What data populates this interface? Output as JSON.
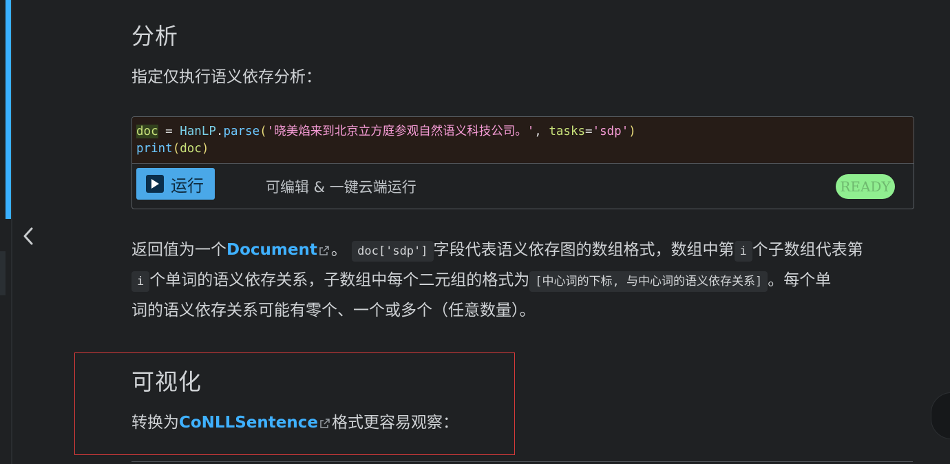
{
  "section_analysis": {
    "heading": "分析",
    "intro": "指定仅执行语义依存分析："
  },
  "code": {
    "line1": {
      "var": "doc",
      "op": " = ",
      "cls": "HanLP",
      "dot": ".",
      "fn": "parse",
      "open": "(",
      "str1": "'晓美焰来到北京立方庭参观自然语义科技公司。'",
      "comma": ", ",
      "kw": "tasks",
      "eq": "=",
      "str2": "'sdp'",
      "close": ")"
    },
    "line2": {
      "fn": "print",
      "open": "(",
      "arg": "doc",
      "close": ")"
    },
    "run_label": "运行",
    "hint": "可编辑 & 一键云端运行",
    "status": "READY"
  },
  "result_paragraph": {
    "p1": "返回值为一个",
    "link": "Document",
    "p2": "。",
    "code1": "doc['sdp']",
    "p3": "字段代表语义依存图的数组格式，数组中第",
    "code2": "i",
    "p4": "个子数组代表第",
    "code3": "i",
    "p5": "个单词的语义依存关系，子数组中每个二元组的格式为",
    "code4": "[中心词的下标, 与中心词的语义依存关系]",
    "p6": "。每个单",
    "p7": "词的语义依存关系可能有零个、一个或多个（任意数量）。"
  },
  "section_visualize": {
    "heading": "可视化",
    "p1": "转换为",
    "link": "CoNLLSentence",
    "p2": "格式更容易观察："
  },
  "colors": {
    "accent": "#3ab0ff",
    "link": "#3fb1ff",
    "run_button": "#4aa8e8",
    "ready_badge": "#90ee90",
    "highlight_border": "#d63a3a"
  }
}
